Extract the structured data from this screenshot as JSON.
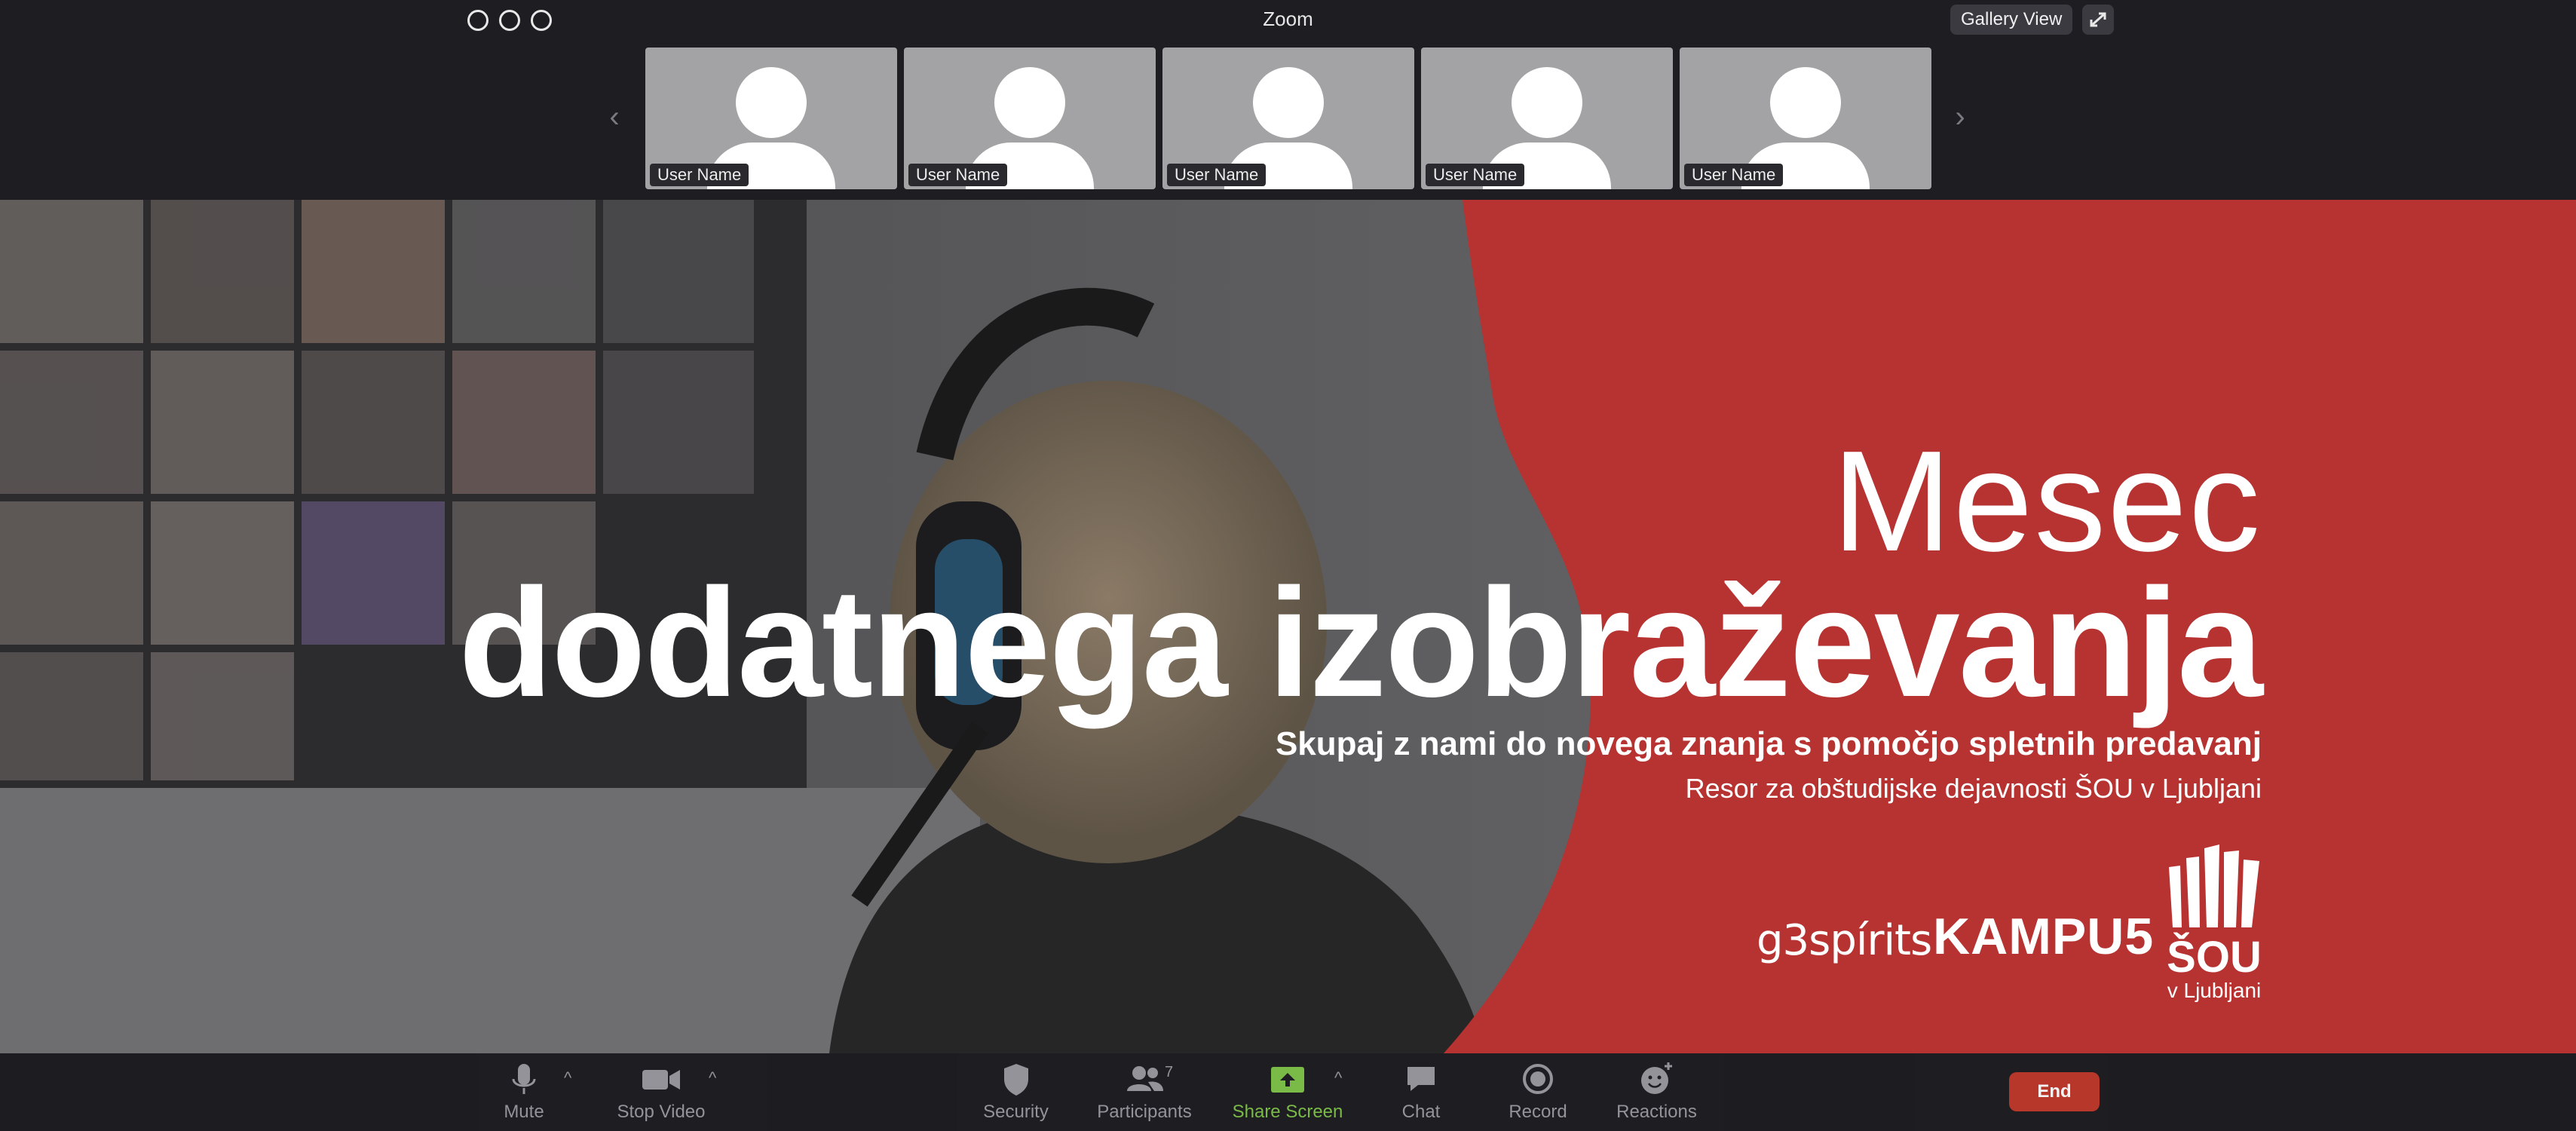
{
  "window": {
    "title": "Zoom",
    "gallery_label": "Gallery View"
  },
  "tiles": [
    {
      "name": "User Name"
    },
    {
      "name": "User Name"
    },
    {
      "name": "User Name"
    },
    {
      "name": "User Name"
    },
    {
      "name": "User Name"
    }
  ],
  "slide": {
    "headline_light": "Mesec",
    "headline_bold": "dodatnega izobraževanja",
    "subline": "Skupaj z nami do novega znanja s pomočjo spletnih predavanj",
    "subline2": "Resor za obštudijske dejavnosti ŠOU v Ljubljani",
    "logos": {
      "g3": "g3spírits",
      "kampus": "KAMPU5",
      "sou_main": "ŠOU",
      "sou_sub": "v Ljubljani"
    },
    "colors": {
      "accent_red": "#b63332",
      "photo_shade": "#3c3c3e"
    }
  },
  "toolbar": {
    "mute": "Mute",
    "stop_video": "Stop Video",
    "security": "Security",
    "participants": "Participants",
    "participants_count": "7",
    "share_screen": "Share Screen",
    "chat": "Chat",
    "record": "Record",
    "reactions": "Reactions",
    "end": "End",
    "share_color": "#7fc34a"
  }
}
